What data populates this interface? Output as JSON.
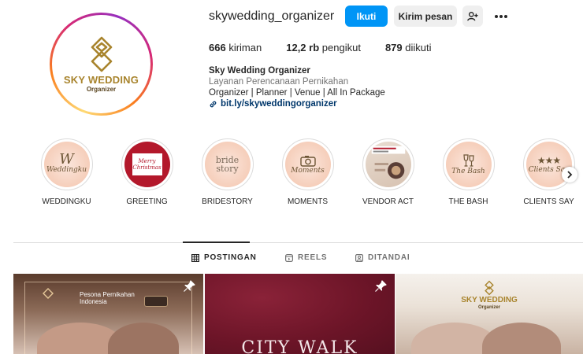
{
  "profile": {
    "username": "skywedding_organizer",
    "logo_title": "SKY WEDDING",
    "logo_subtitle": "Organizer",
    "follow_label": "Ikuti",
    "message_label": "Kirim pesan",
    "stats": {
      "posts_count": "666",
      "posts_label": "kiriman",
      "followers_count": "12,2 rb",
      "followers_label": "pengikut",
      "following_count": "879",
      "following_label": "diikuti"
    },
    "bio": {
      "name": "Sky Wedding Organizer",
      "category": "Layanan Perencanaan Pernikahan",
      "description": "Organizer | Planner | Venue | All In Package",
      "link": "bit.ly/skyweddingorganizer"
    }
  },
  "highlights": [
    {
      "label": "WEDDINGKU",
      "thumb": "Weddingku",
      "icon": "weddingku-logo"
    },
    {
      "label": "GREETING",
      "thumb": "Merry Christmas",
      "icon": "christmas-card"
    },
    {
      "label": "BRIDESTORY",
      "thumb": "bride story",
      "icon": "bridestory-logo"
    },
    {
      "label": "MOMENTS",
      "thumb": "Moments",
      "icon": "camera-icon"
    },
    {
      "label": "VENDOR ACT",
      "thumb": "",
      "icon": "vendor-photo"
    },
    {
      "label": "THE BASH",
      "thumb": "The Bash",
      "icon": "glasses-icon"
    },
    {
      "label": "CLIENTS SAY",
      "thumb": "Clients Say",
      "icon": "stars-icon"
    }
  ],
  "tabs": [
    {
      "label": "POSTINGAN",
      "icon": "grid-icon",
      "active": true
    },
    {
      "label": "REELS",
      "icon": "reels-icon",
      "active": false
    },
    {
      "label": "DITANDAI",
      "icon": "tagged-icon",
      "active": false
    }
  ],
  "posts": {
    "post1_text": "Pesona Pernikahan Indonesia",
    "post2_title": "CITY WALK",
    "post3_logo_title": "SKY WEDDING",
    "post3_logo_subtitle": "Organizer"
  },
  "colors": {
    "accent": "#0095f6",
    "gold": "#a8842d",
    "link": "#00376b"
  }
}
